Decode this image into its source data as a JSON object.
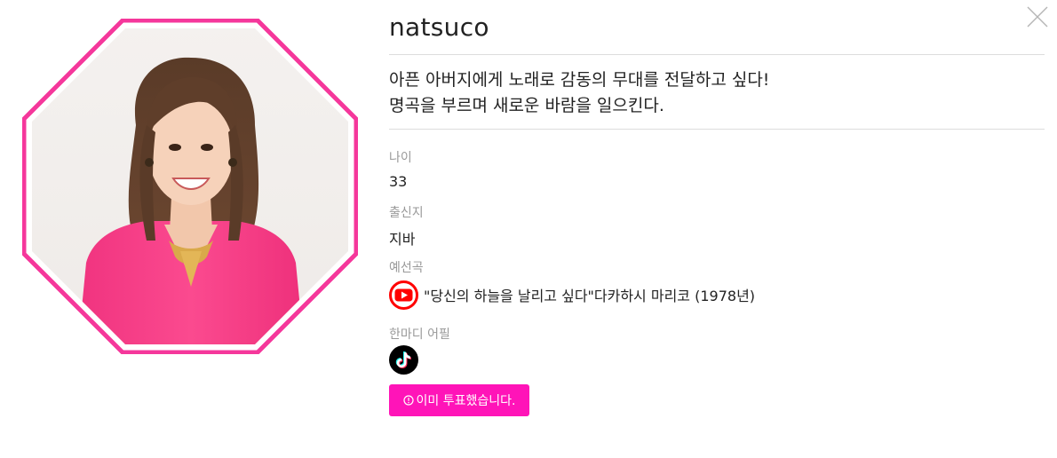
{
  "profile": {
    "name": "natsuco",
    "intro_line1": "아픈 아버지에게 노래로 감동의 무대를 전달하고 싶다!",
    "intro_line2": "명곡을 부르며 새로운 바람을 일으킨다.",
    "age_label": "나이",
    "age_value": "33",
    "hometown_label": "출신지",
    "hometown_value": "지바",
    "song_label": "예선곡",
    "song_value": "\"당신의 하늘을 날리고 싶다\"다카하시 마리코 (1978년)",
    "appeal_label": "한마디 어필",
    "photo_alt": "natsuco"
  },
  "vote_button": {
    "label": "이미 투표했습니다."
  },
  "icons": {
    "close": "close-icon",
    "youtube": "youtube-icon",
    "tiktok": "tiktok-icon",
    "info": "info-circle-icon"
  },
  "colors": {
    "frame": "#f5379b",
    "vote_button": "#ff14b8",
    "youtube_red": "#ff0000",
    "label_gray": "#999999"
  }
}
